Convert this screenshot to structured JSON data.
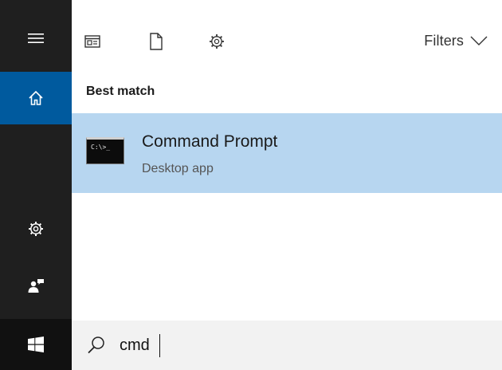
{
  "rail": {
    "items": [
      {
        "name": "menu",
        "icon": "hamburger-icon"
      },
      {
        "name": "home",
        "icon": "home-icon",
        "active": true
      },
      {
        "name": "settings",
        "icon": "gear-icon"
      },
      {
        "name": "feedback",
        "icon": "feedback-icon"
      },
      {
        "name": "start",
        "icon": "windows-logo-icon"
      }
    ],
    "accent_color": "#005a9e"
  },
  "toolbar": {
    "icons": [
      "apps-icon",
      "documents-icon",
      "web-settings-icon"
    ],
    "filters_label": "Filters"
  },
  "results": {
    "section_header": "Best match",
    "best_match": {
      "title": "Command Prompt",
      "subtitle": "Desktop app",
      "icon": "command-prompt-icon",
      "icon_text": "C:\\>_",
      "highlight_color": "#b7d6f0"
    }
  },
  "search": {
    "value": "cmd",
    "icon": "search-icon"
  }
}
